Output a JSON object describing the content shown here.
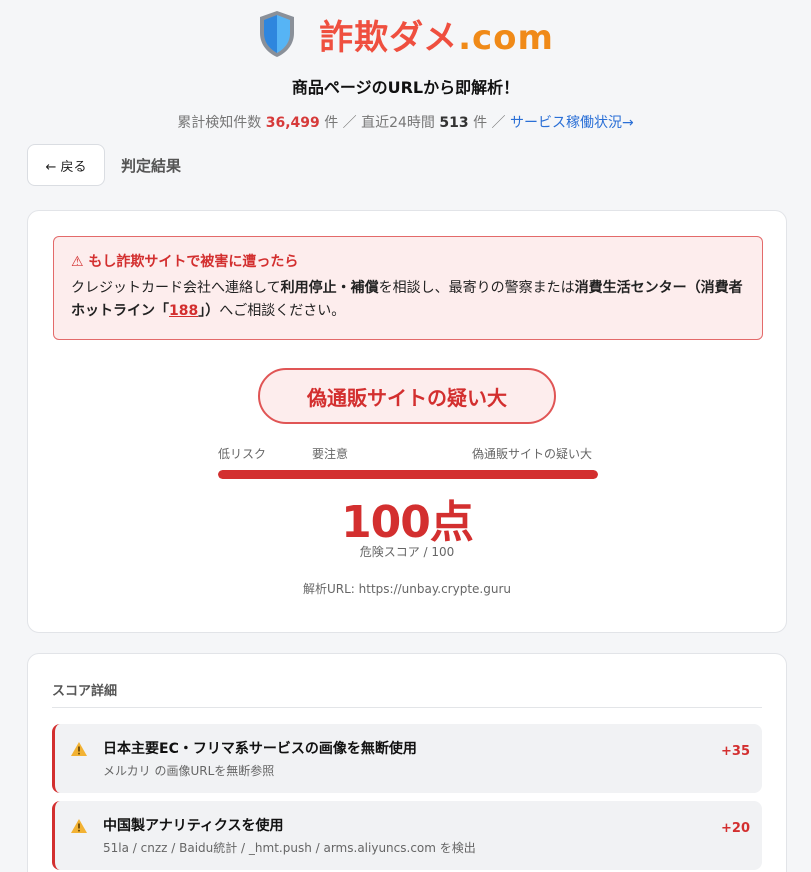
{
  "brand": {
    "name_jp": "詐欺ダメ",
    "name_domain": ".com"
  },
  "tagline": "商品ページのURLから即解析！",
  "stats": {
    "total_label": "累計検知件数",
    "total_value": "36,499",
    "unit1": "件 ／ 直近24時間",
    "recent_value": "513",
    "unit2": "件 ／",
    "status_link": "サービス稼働状況→"
  },
  "nav": {
    "back_label": "← 戻る",
    "title": "判定結果"
  },
  "warning": {
    "title": "⚠ もし詐欺サイトで被害に遭ったら",
    "p1": "クレジットカード会社へ連絡して",
    "b1": "利用停止・補償",
    "p2": "を相談し、最寄りの警察または",
    "b2": "消費生活センター（消費者ホットライン「",
    "hotline": "188",
    "b3": "」）",
    "p3": "へご相談ください。"
  },
  "result": {
    "verdict": "偽通販サイトの疑い大",
    "scale_labels": {
      "low": "低リスク",
      "mid": "要注意",
      "high": "偽通販サイトの疑い大"
    },
    "score_fraction": 1.0,
    "score_display": "100点",
    "score_caption": "危険スコア / 100",
    "url_text": "解析URL: https://unbay.crypte.guru"
  },
  "details": {
    "title": "スコア詳細",
    "items": [
      {
        "title": "日本主要EC・フリマ系サービスの画像を無断使用",
        "desc": "メルカリ の画像URLを無断参照",
        "points": "+35"
      },
      {
        "title": "中国製アナリティクスを使用",
        "desc": "51la / cnzz / Baidu統計 / _hmt.push / arms.aliyuncs.com を検出",
        "points": "+20"
      }
    ]
  },
  "colors": {
    "danger": "#d32f2f",
    "brand_red": "#ef4f3f",
    "brand_orange": "#f08a18",
    "link": "#2a6fd6"
  },
  "icons": {
    "logo": "shield-icon",
    "warning": "warning-triangle-icon"
  }
}
